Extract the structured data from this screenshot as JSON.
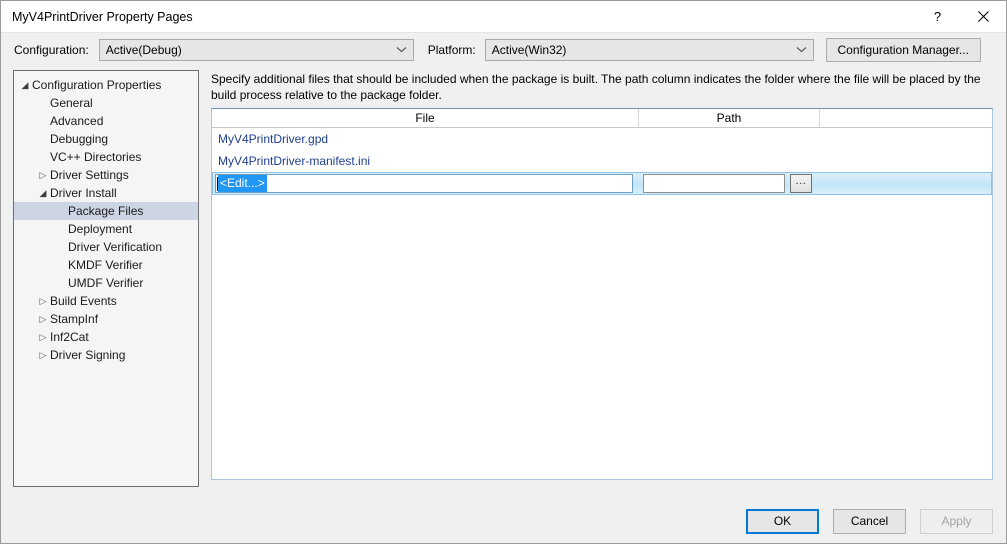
{
  "window": {
    "title": "MyV4PrintDriver Property Pages",
    "help_icon": "question-mark-icon",
    "close_icon": "close-icon"
  },
  "configbar": {
    "configuration_label": "Configuration:",
    "configuration_value": "Active(Debug)",
    "platform_label": "Platform:",
    "platform_value": "Active(Win32)",
    "config_manager_label": "Configuration Manager...",
    "chevron_icon": "chevron-down-icon"
  },
  "sidebar": {
    "items": [
      {
        "label": "Configuration Properties",
        "level": 0,
        "expander": "expanded",
        "selected": false
      },
      {
        "label": "General",
        "level": 1,
        "expander": "none",
        "selected": false
      },
      {
        "label": "Advanced",
        "level": 1,
        "expander": "none",
        "selected": false
      },
      {
        "label": "Debugging",
        "level": 1,
        "expander": "none",
        "selected": false
      },
      {
        "label": "VC++ Directories",
        "level": 1,
        "expander": "none",
        "selected": false
      },
      {
        "label": "Driver Settings",
        "level": 1,
        "expander": "collapsed",
        "selected": false
      },
      {
        "label": "Driver Install",
        "level": 1,
        "expander": "expanded",
        "selected": false
      },
      {
        "label": "Package Files",
        "level": 2,
        "expander": "none",
        "selected": true
      },
      {
        "label": "Deployment",
        "level": 2,
        "expander": "none",
        "selected": false
      },
      {
        "label": "Driver Verification",
        "level": 2,
        "expander": "none",
        "selected": false
      },
      {
        "label": "KMDF Verifier",
        "level": 2,
        "expander": "none",
        "selected": false
      },
      {
        "label": "UMDF Verifier",
        "level": 2,
        "expander": "none",
        "selected": false
      },
      {
        "label": "Build Events",
        "level": 1,
        "expander": "collapsed",
        "selected": false
      },
      {
        "label": "StampInf",
        "level": 1,
        "expander": "collapsed",
        "selected": false
      },
      {
        "label": "Inf2Cat",
        "level": 1,
        "expander": "collapsed",
        "selected": false
      },
      {
        "label": "Driver Signing",
        "level": 1,
        "expander": "collapsed",
        "selected": false
      }
    ],
    "expander_collapsed_glyph": "▷",
    "expander_expanded_glyph": "◢"
  },
  "main": {
    "description": "Specify additional files that should be included when the package is built.  The path column indicates the folder where the file will be placed by the build process relative to the package folder.",
    "grid": {
      "columns": [
        "File",
        "Path",
        ""
      ],
      "rows": [
        {
          "file": "MyV4PrintDriver.gpd",
          "path": ""
        },
        {
          "file": "MyV4PrintDriver-manifest.ini",
          "path": ""
        }
      ],
      "edit_row": {
        "file_value": "<Edit...>",
        "path_value": "",
        "browse_label": "...",
        "browse_icon": "ellipsis-icon"
      }
    }
  },
  "footer": {
    "ok_label": "OK",
    "cancel_label": "Cancel",
    "apply_label": "Apply"
  },
  "colors": {
    "accent": "#0078d7",
    "selection": "#2196f3",
    "link_text": "#1f3f8f",
    "tree_selected": "#cdd4e4",
    "window_bg": "#f0f0f0"
  }
}
